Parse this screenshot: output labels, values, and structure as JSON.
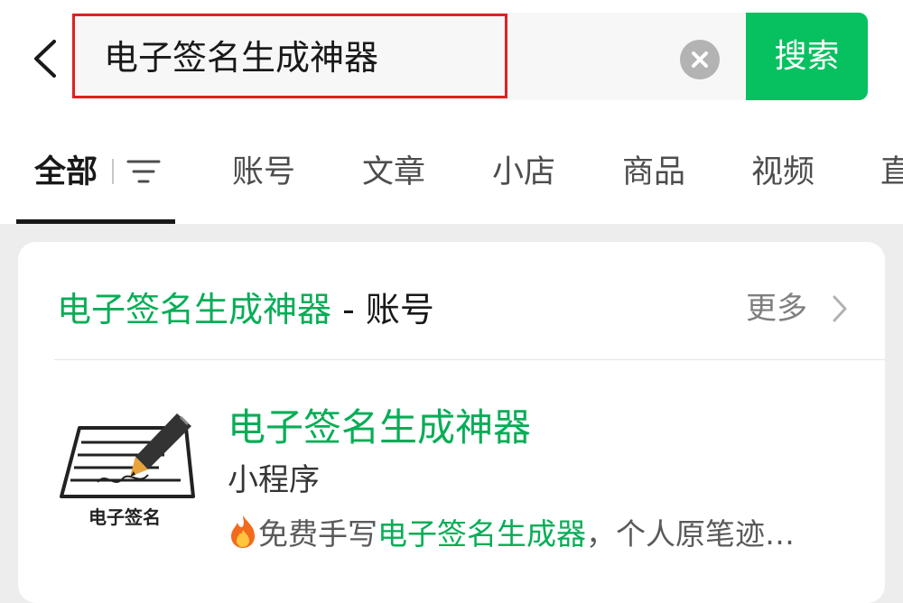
{
  "search": {
    "query": "电子签名生成神器",
    "button_label": "搜索"
  },
  "tabs": {
    "all": "全部",
    "accounts": "账号",
    "articles": "文章",
    "shops": "小店",
    "products": "商品",
    "videos": "视频",
    "live_partial": "直"
  },
  "section": {
    "keyword": "电子签名生成神器",
    "separator_suffix": " - 账号",
    "more": "更多"
  },
  "result": {
    "name": "电子签名生成神器",
    "type": "小程序",
    "desc_prefix": "免费手写",
    "desc_highlight": "电子签名生成器",
    "desc_suffix": "，个人原笔迹…",
    "logo_caption": "电子签名",
    "logo_icon": "pen-signature-icon",
    "desc_icon": "fire-icon"
  },
  "colors": {
    "accent_green": "#07c160",
    "highlight_green": "#07ad56",
    "highlight_box": "#e02020"
  }
}
